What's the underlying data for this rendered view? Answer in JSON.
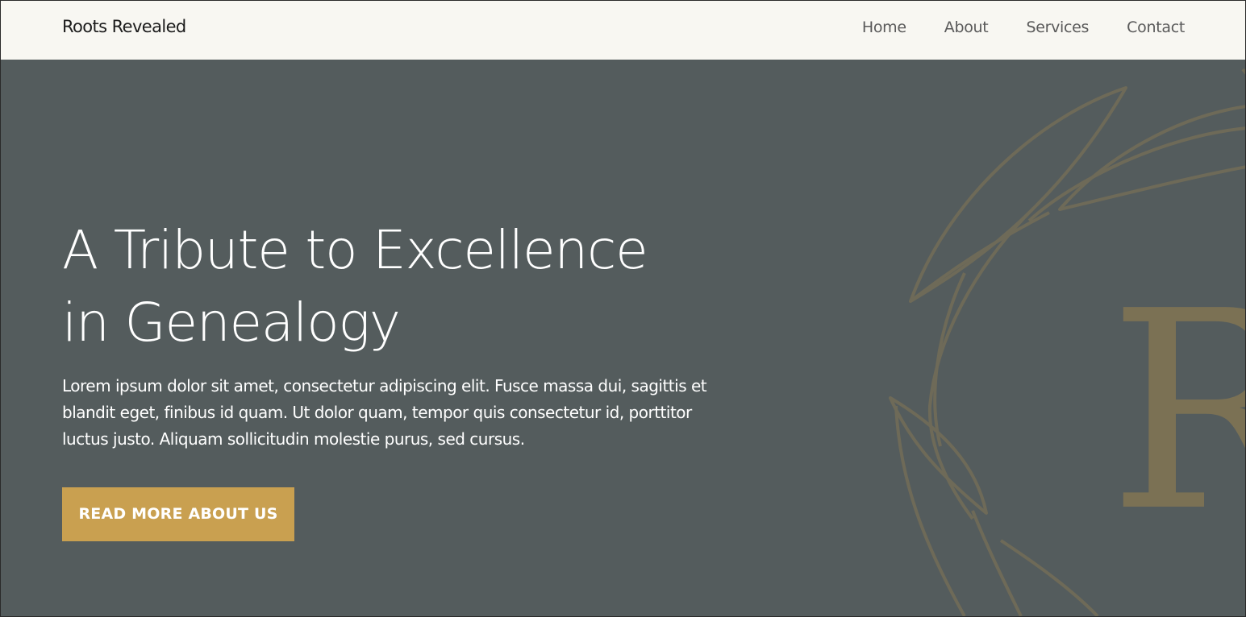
{
  "header": {
    "brand": "Roots Revealed",
    "nav": [
      "Home",
      "About",
      "Services",
      "Contact"
    ]
  },
  "hero": {
    "title_line1": "A Tribute to Excellence",
    "title_line2": "in Genealogy",
    "body": "Lorem ipsum dolor sit amet, consectetur adipiscing elit. Fusce massa dui, sagittis et blandit eget, finibus id quam. Ut dolor quam, tempor quis consectetur id, porttitor luctus justo. Aliquam sollicitudin molestie purus, sed cursus.",
    "cta_label": "READ MORE ABOUT US",
    "emblem_letter": "R"
  },
  "colors": {
    "header_bg": "#f8f7f2",
    "hero_bg": "#545c5d",
    "accent": "#c9a050",
    "emblem": "#7b7154"
  }
}
